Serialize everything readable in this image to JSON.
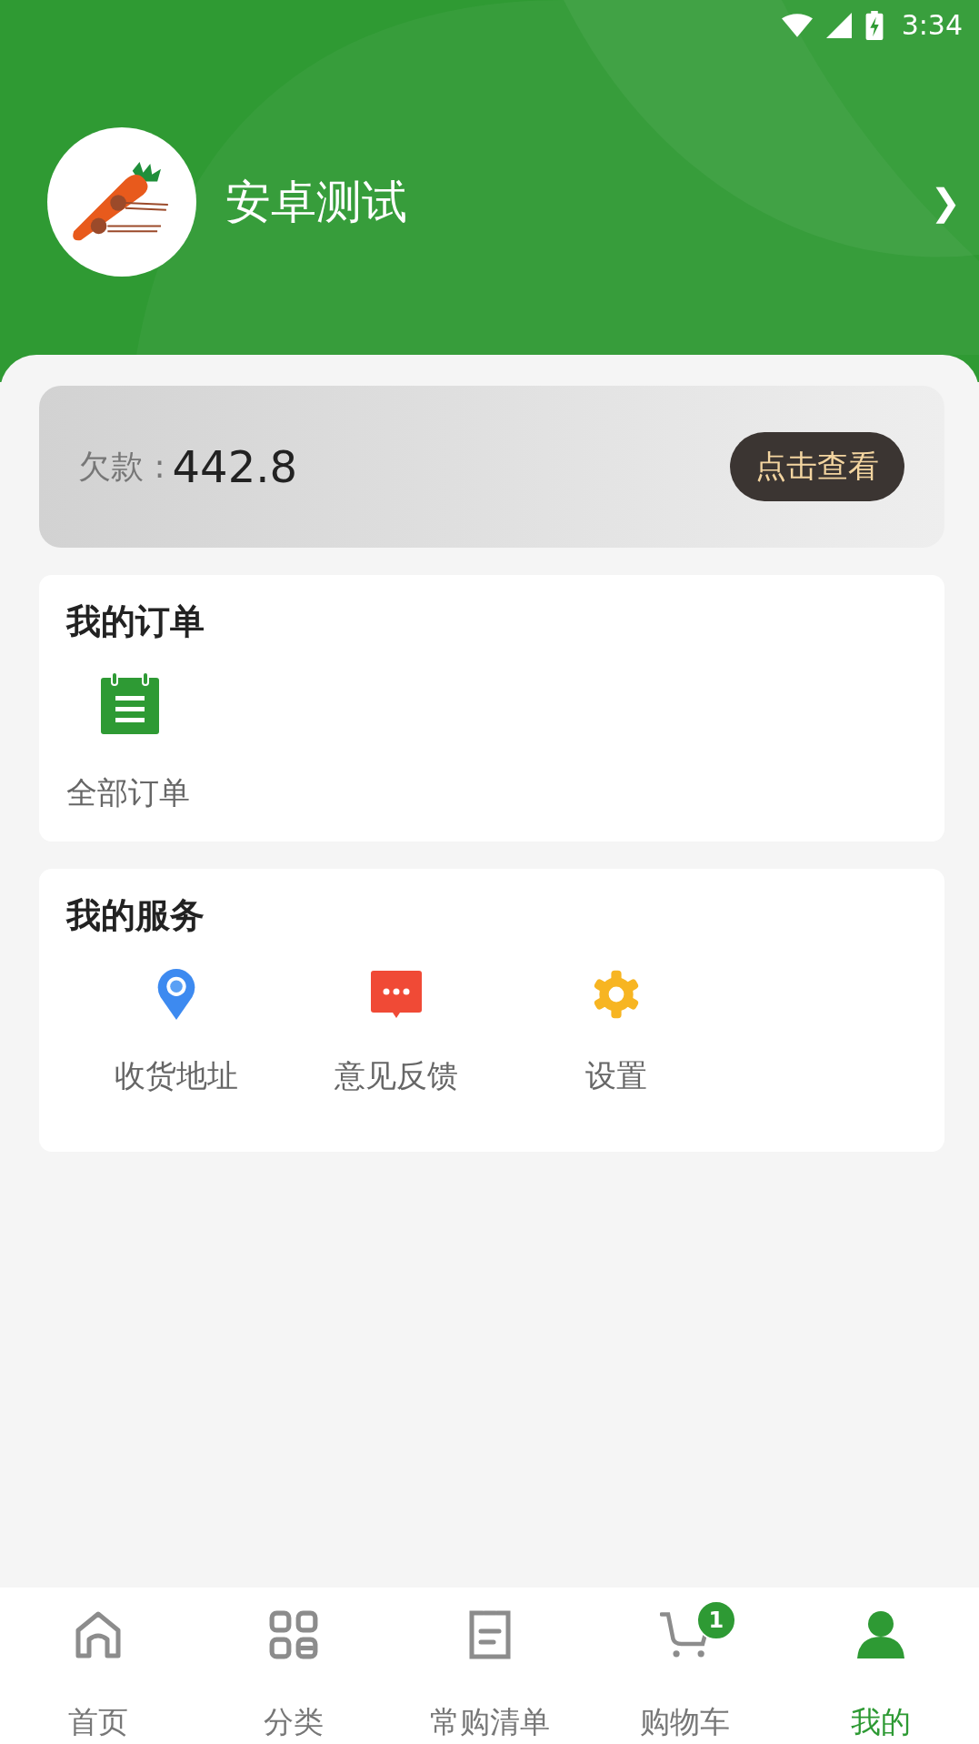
{
  "status_bar": {
    "time": "3:34"
  },
  "profile": {
    "name": "安卓测试",
    "chevron": "❯"
  },
  "debt": {
    "label": "欠款 :",
    "amount": "442.8",
    "button": "点击查看"
  },
  "orders": {
    "title": "我的订单",
    "items": [
      {
        "label": "全部订单",
        "kind": "clipboard"
      }
    ]
  },
  "services": {
    "title": "我的服务",
    "items": [
      {
        "label": "收货地址",
        "kind": "location"
      },
      {
        "label": "意见反馈",
        "kind": "message"
      },
      {
        "label": "设置",
        "kind": "gear"
      }
    ]
  },
  "tab_bar": [
    {
      "label": "首页",
      "kind": "home",
      "selected": false
    },
    {
      "label": "分类",
      "kind": "grid",
      "selected": false
    },
    {
      "label": "常购清单",
      "kind": "list",
      "selected": false
    },
    {
      "label": "购物车",
      "kind": "cart",
      "selected": false,
      "badge": "1"
    },
    {
      "label": "我的",
      "kind": "person",
      "selected": true
    }
  ]
}
